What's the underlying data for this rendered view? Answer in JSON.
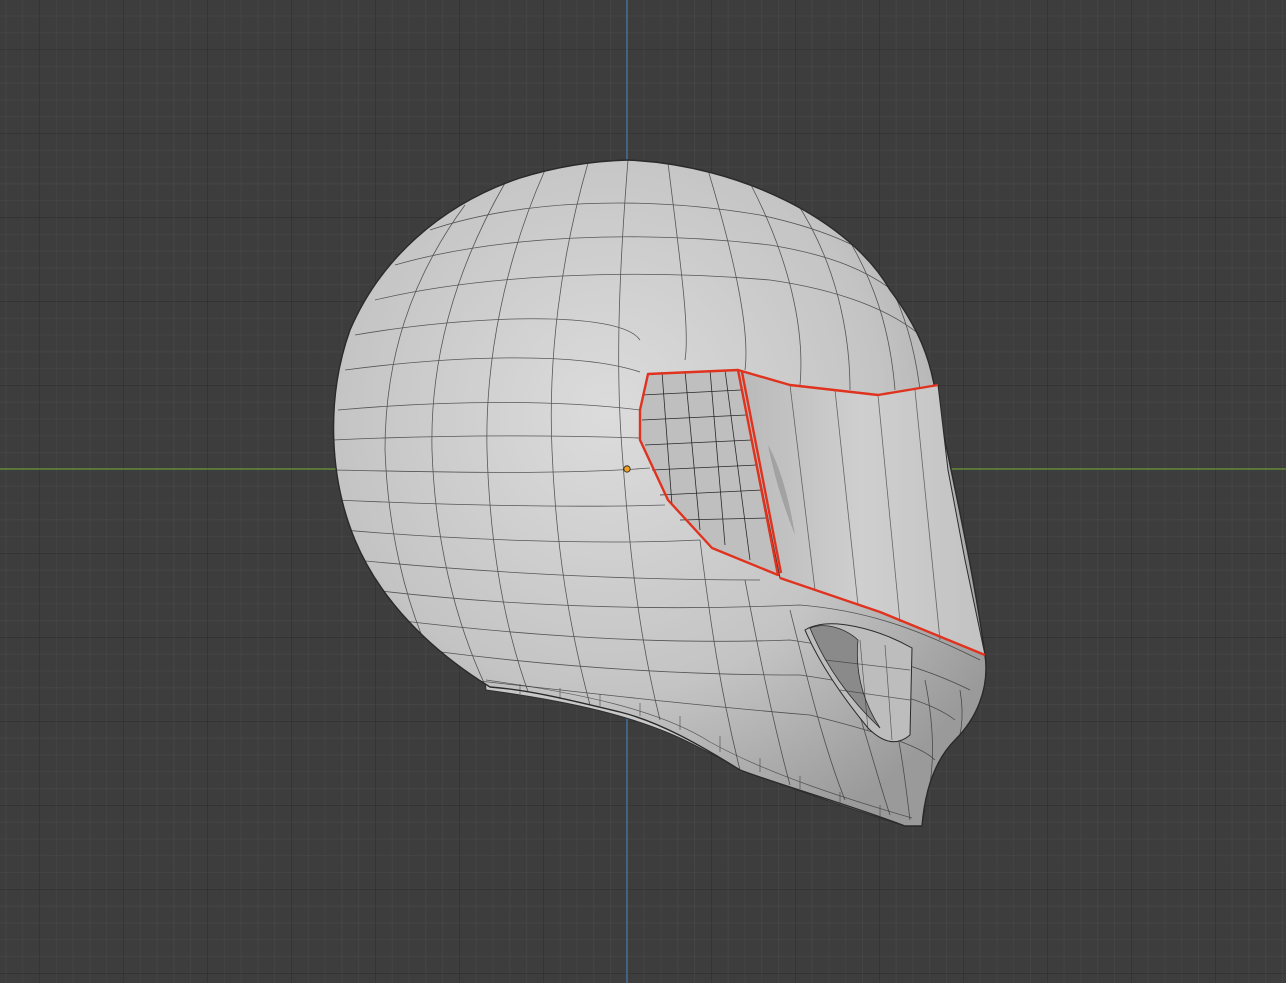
{
  "viewport": {
    "background_color": "#3d3d3d",
    "x_axis_color": "#6f9a3a",
    "z_axis_color": "#4a7fb6"
  },
  "object": {
    "kind": "helmet-mesh",
    "shell_color": "#cfcfcf",
    "wire_color": "#2b2b2b",
    "selected_edge_color": "#e0331f",
    "origin_color": "#f0a020"
  }
}
